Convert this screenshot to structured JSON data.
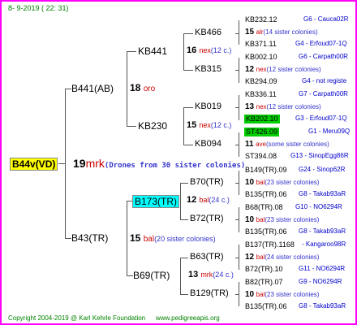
{
  "header": {
    "date": "8-  9-2019 ( 22: 31)"
  },
  "footer": {
    "copyright": "Copyright 2004-2019 @ Karl Kehrle Foundation",
    "site": "www.pedigreeapis.org"
  },
  "queen": {
    "name": "B44v(VD)"
  },
  "root": {
    "num": "19",
    "mark": "mrk",
    "note": "(Drones from 30 sister colonies)"
  },
  "dam": {
    "name": "B441(AB)",
    "num": "18",
    "mark": "oro"
  },
  "sire": {
    "name": "B43(TR)",
    "num": "15",
    "mark": "bal",
    "note": "(20 sister colonies)"
  },
  "g3": [
    {
      "name": "KB441",
      "num": "16",
      "mark": "nex",
      "note": "(12 c.)"
    },
    {
      "name": "KB230",
      "num": "15",
      "mark": "nex",
      "note": "(12 c.)"
    },
    {
      "name": "B173(TR)",
      "num": "12",
      "mark": "bal",
      "note": "(24 c.)"
    },
    {
      "name": "B69(TR)",
      "num": "13",
      "mark": "mrk",
      "note": "(24 c.)"
    }
  ],
  "g4": [
    {
      "name": "KB466"
    },
    {
      "name": "KB315"
    },
    {
      "name": "KB019"
    },
    {
      "name": "KB094"
    },
    {
      "name": "B70(TR)"
    },
    {
      "name": "B72(TR)"
    },
    {
      "name": "B63(TR)"
    },
    {
      "name": "B129(TR)"
    }
  ],
  "g5": [
    {
      "name": "KB232.12",
      "info": "G6 - Cauca02R"
    },
    {
      "num": "15",
      "mark": "alr",
      "note": "(14 sister colonies)"
    },
    {
      "name": "KB371.11",
      "info": "G4 - Erfoud07-1Q"
    },
    {
      "name": "KB002.10",
      "info": "G6 - Carpath00R"
    },
    {
      "num": "12",
      "mark": "nex",
      "note": "(12 sister colonies)"
    },
    {
      "name": "KB294.09",
      "info": "G4 - not registe"
    },
    {
      "name": "KB336.11",
      "info": "G7 - Carpath00R"
    },
    {
      "num": "13",
      "mark": "nex",
      "note": "(12 sister colonies)"
    },
    {
      "name": "KB202.10",
      "info": "G3 - Erfoud07-1Q"
    },
    {
      "name": "ST426.09",
      "info": "G1 - Meru09Q"
    },
    {
      "num": "11",
      "mark": "ave",
      "note": "(some sister colonies)"
    },
    {
      "name": "ST394.08",
      "info": "G13 - SinopEgg86R"
    },
    {
      "name": "B149(TR).09",
      "info": "G24 - Sinop62R"
    },
    {
      "num": "10",
      "mark": "bal",
      "note": "(23 sister colonies)"
    },
    {
      "name": "B135(TR).06",
      "info": "G8 - Takab93aR"
    },
    {
      "name": "B68(TR).08",
      "info": "G10 - NO6294R"
    },
    {
      "num": "10",
      "mark": "bal",
      "note": "(23 sister colonies)"
    },
    {
      "name": "B135(TR).06",
      "info": "G8 - Takab93aR"
    },
    {
      "name": "B137(TR).1168",
      "info": "- Kangaroo98R"
    },
    {
      "num": "12",
      "mark": "bal",
      "note": "(24 sister colonies)"
    },
    {
      "name": "B72(TR).10",
      "info": "G11 - NO6294R"
    },
    {
      "name": "B82(TR).07",
      "info": "G9 - NO6294R"
    },
    {
      "num": "10",
      "mark": "bal",
      "note": "(23 sister colonies)"
    },
    {
      "name": "B135(TR).06",
      "info": "G8 - Takab93aR"
    }
  ],
  "colors": {
    "border": "#ff00ff",
    "green_text": "#008000",
    "blue_info": "#0000cc",
    "mark_red": "#cc0000",
    "queen_bg": "#ffff00",
    "cyan_bg": "#00ffff",
    "green_bg": "#00cc00"
  }
}
